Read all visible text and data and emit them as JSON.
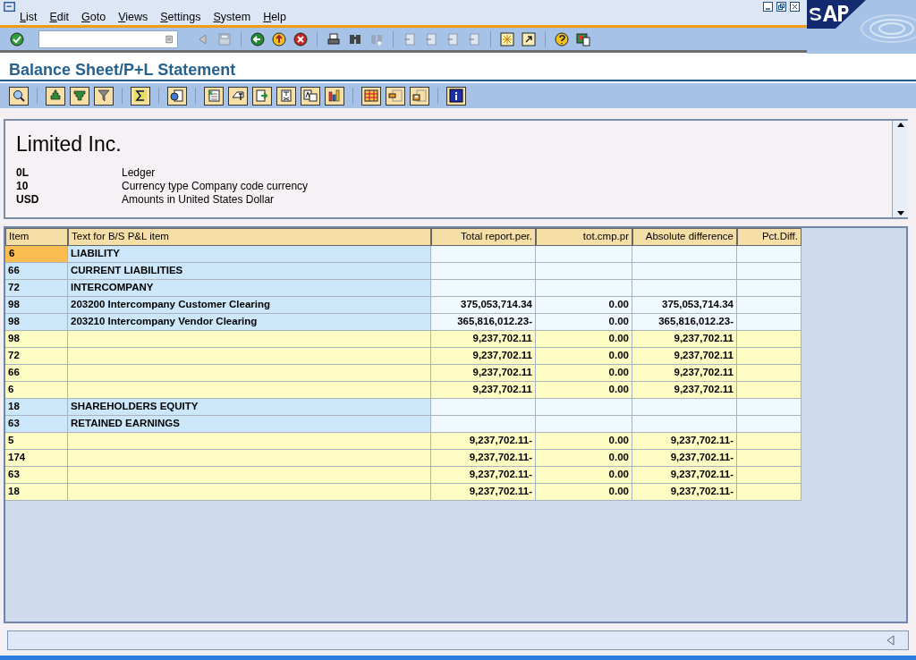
{
  "menu": [
    "List",
    "Edit",
    "Goto",
    "Views",
    "Settings",
    "System",
    "Help"
  ],
  "title": "Balance Sheet/P+L Statement",
  "header": {
    "company": "Limited Inc.",
    "lines": [
      {
        "code": "0L",
        "text": "Ledger"
      },
      {
        "code": "10",
        "text": "Currency type Company code currency"
      },
      {
        "code": "USD",
        "text": "Amounts in United States Dollar"
      }
    ]
  },
  "table": {
    "columns": [
      "Item",
      "Text for B/S P&L item",
      "Total report.per.",
      "tot.cmp.pr",
      "Absolute difference",
      "Pct.Diff."
    ],
    "rows": [
      {
        "kind": "line",
        "selected": true,
        "cells": [
          "6",
          "LIABILITY",
          "",
          "",
          "",
          ""
        ]
      },
      {
        "kind": "line",
        "selected": false,
        "cells": [
          "66",
          "CURRENT LIABILITIES",
          "",
          "",
          "",
          ""
        ]
      },
      {
        "kind": "line",
        "selected": false,
        "cells": [
          "72",
          "INTERCOMPANY",
          "",
          "",
          "",
          ""
        ]
      },
      {
        "kind": "line",
        "selected": false,
        "cells": [
          "98",
          "203200 Intercompany Customer Clearing",
          "375,053,714.34",
          "0.00",
          "375,053,714.34",
          ""
        ]
      },
      {
        "kind": "line",
        "selected": false,
        "cells": [
          "98",
          "203210 Intercompany Vendor Clearing",
          "365,816,012.23-",
          "0.00",
          "365,816,012.23-",
          ""
        ]
      },
      {
        "kind": "total",
        "selected": false,
        "cells": [
          "98",
          "",
          "9,237,702.11",
          "0.00",
          "9,237,702.11",
          ""
        ]
      },
      {
        "kind": "total",
        "selected": false,
        "cells": [
          "72",
          "",
          "9,237,702.11",
          "0.00",
          "9,237,702.11",
          ""
        ]
      },
      {
        "kind": "total",
        "selected": false,
        "cells": [
          "66",
          "",
          "9,237,702.11",
          "0.00",
          "9,237,702.11",
          ""
        ]
      },
      {
        "kind": "total",
        "selected": false,
        "cells": [
          "6",
          "",
          "9,237,702.11",
          "0.00",
          "9,237,702.11",
          ""
        ]
      },
      {
        "kind": "line",
        "selected": false,
        "cells": [
          "18",
          "SHAREHOLDERS EQUITY",
          "",
          "",
          "",
          ""
        ]
      },
      {
        "kind": "line",
        "selected": false,
        "cells": [
          "63",
          "RETAINED EARNINGS",
          "",
          "",
          "",
          ""
        ]
      },
      {
        "kind": "total",
        "selected": false,
        "cells": [
          "5",
          "",
          "9,237,702.11-",
          "0.00",
          "9,237,702.11-",
          ""
        ]
      },
      {
        "kind": "total",
        "selected": false,
        "cells": [
          "174",
          "",
          "9,237,702.11-",
          "0.00",
          "9,237,702.11-",
          ""
        ]
      },
      {
        "kind": "total",
        "selected": false,
        "cells": [
          "63",
          "",
          "9,237,702.11-",
          "0.00",
          "9,237,702.11-",
          ""
        ]
      },
      {
        "kind": "total",
        "selected": false,
        "cells": [
          "18",
          "",
          "9,237,702.11-",
          "0.00",
          "9,237,702.11-",
          ""
        ]
      }
    ]
  }
}
